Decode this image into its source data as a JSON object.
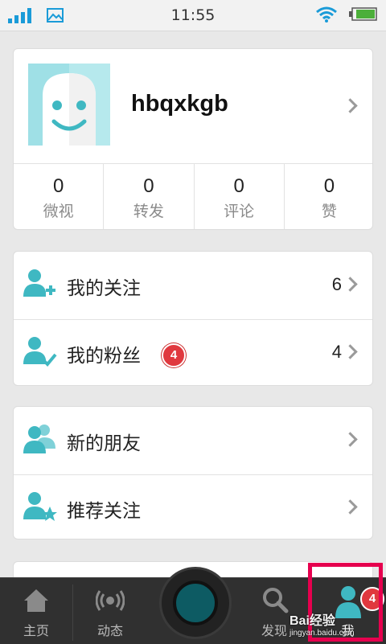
{
  "status_bar": {
    "time": "11:55",
    "icons": [
      "signal-icon",
      "image-icon",
      "wifi-icon",
      "battery-icon"
    ]
  },
  "profile": {
    "username": "hbqxkgb",
    "avatar_icon": "ghost-face-avatar",
    "chevron_icon": "chevron-right-icon"
  },
  "stats": [
    {
      "value": "0",
      "label": "微视"
    },
    {
      "value": "0",
      "label": "转发"
    },
    {
      "value": "0",
      "label": "评论"
    },
    {
      "value": "0",
      "label": "赞"
    }
  ],
  "menu_group1": [
    {
      "icon": "user-add-icon",
      "label": "我的关注",
      "count": "6"
    },
    {
      "icon": "user-check-icon",
      "label": "我的粉丝",
      "badge": "4",
      "count": "4"
    }
  ],
  "menu_group2": [
    {
      "icon": "users-icon",
      "label": "新的朋友"
    },
    {
      "icon": "user-star-icon",
      "label": "推荐关注"
    }
  ],
  "tab_bar": {
    "tabs": [
      {
        "icon": "home-icon",
        "label": "主页"
      },
      {
        "icon": "broadcast-icon",
        "label": "动态"
      },
      {
        "icon": "camera-icon",
        "label": ""
      },
      {
        "icon": "search-icon",
        "label": "发现"
      },
      {
        "icon": "person-icon",
        "label": "我",
        "badge": "4"
      }
    ]
  },
  "watermark": {
    "brand": "Bai经验",
    "url": "jingyan.baidu.com"
  },
  "colors": {
    "accent": "#3fb8c2",
    "highlight": "#e6004e",
    "badge": "#e0383e",
    "tabbar": "#303030"
  }
}
